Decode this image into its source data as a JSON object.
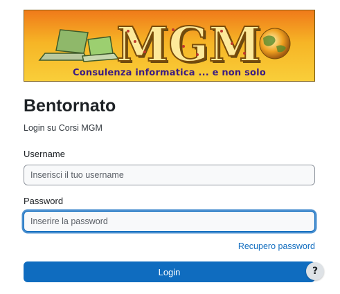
{
  "banner": {
    "logo_text": "MGM",
    "tagline": "Consulenza informatica ... e non solo"
  },
  "login": {
    "heading": "Bentornato",
    "subtitle": "Login su Corsi MGM",
    "username_label": "Username",
    "username_placeholder": "Inserisci il tuo username",
    "username_value": "",
    "password_label": "Password",
    "password_placeholder": "Inserire la password",
    "password_value": "",
    "forgot_link": "Recupero password",
    "submit_label": "Login"
  },
  "help": {
    "label": "?"
  },
  "colors": {
    "primary": "#0f6cbf",
    "banner_bg": "#f5a623",
    "tagline": "#3b1b82"
  }
}
